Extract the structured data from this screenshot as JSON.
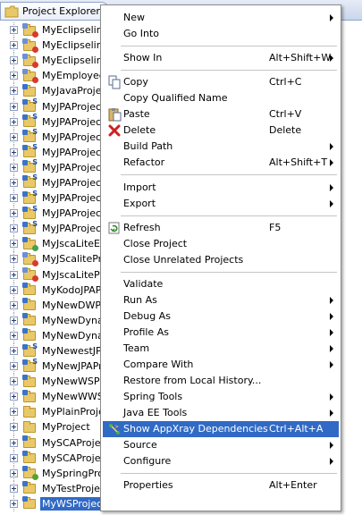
{
  "view": {
    "tab_label": "Project Explorer",
    "projects": [
      {
        "label": "MyEclipselinkJ",
        "icon": "project-error-icon"
      },
      {
        "label": "MyEclipselinkJ",
        "icon": "project-error-icon"
      },
      {
        "label": "MyEclipselinkJ",
        "icon": "project-error-icon"
      },
      {
        "label": "MyEmployeeJ",
        "icon": "project-error-icon"
      },
      {
        "label": "MyJavaProject",
        "icon": "java-project-icon"
      },
      {
        "label": "MyJPAProject",
        "icon": "jpa-project-icon"
      },
      {
        "label": "MyJPAProject",
        "icon": "jpa-project-icon"
      },
      {
        "label": "MyJPAProject",
        "icon": "jpa-project-icon"
      },
      {
        "label": "MyJPAProject",
        "icon": "jpa-project-icon"
      },
      {
        "label": "MyJPAProject",
        "icon": "jpa-project-icon"
      },
      {
        "label": "MyJPAProject",
        "icon": "jpa-project-icon"
      },
      {
        "label": "MyJPAProject",
        "icon": "jpa-project-icon"
      },
      {
        "label": "MyJPAProject",
        "icon": "jpa-project-icon"
      },
      {
        "label": "MyJPAProject",
        "icon": "jpa-project-icon"
      },
      {
        "label": "MyJscaLiteEAR",
        "icon": "ear-project-icon"
      },
      {
        "label": "MyJScaliteProj",
        "icon": "project-error-icon"
      },
      {
        "label": "MyJscaLitePro",
        "icon": "project-error-icon"
      },
      {
        "label": "MyKodoJPAPr",
        "icon": "project-icon"
      },
      {
        "label": "MyNewDWProj",
        "icon": "project-icon"
      },
      {
        "label": "MyNewDynam",
        "icon": "project-icon"
      },
      {
        "label": "MyNewDynam",
        "icon": "project-icon"
      },
      {
        "label": "MyNewestJPA",
        "icon": "jpa-project-icon"
      },
      {
        "label": "MyNewJPAProj",
        "icon": "jpa-project-icon"
      },
      {
        "label": "MyNewWSProj",
        "icon": "project-icon"
      },
      {
        "label": "MyNewWWSPr",
        "icon": "project-icon"
      },
      {
        "label": "MyPlainProject",
        "icon": "folder-icon"
      },
      {
        "label": "MyProject",
        "icon": "folder-icon"
      },
      {
        "label": "MySCAProject",
        "icon": "project-icon"
      },
      {
        "label": "MySCAProject",
        "icon": "project-icon"
      },
      {
        "label": "MySpringProje",
        "icon": "spring-project-icon"
      },
      {
        "label": "MyTestProject",
        "icon": "project-icon"
      },
      {
        "label": "MyWSProject",
        "icon": "project-icon",
        "selected": true
      }
    ]
  },
  "menu": {
    "items": [
      {
        "type": "item",
        "name": "new",
        "label": "New",
        "shortcut": "",
        "submenu": true
      },
      {
        "type": "item",
        "name": "go-into",
        "label": "Go Into",
        "shortcut": ""
      },
      {
        "type": "sep"
      },
      {
        "type": "item",
        "name": "show-in",
        "label": "Show In",
        "shortcut": "Alt+Shift+W",
        "submenu": true
      },
      {
        "type": "sep"
      },
      {
        "type": "item",
        "name": "copy",
        "label": "Copy",
        "shortcut": "Ctrl+C",
        "icon": "copy-icon"
      },
      {
        "type": "item",
        "name": "copy-qualified-name",
        "label": "Copy Qualified Name",
        "shortcut": "",
        "icon": "copy-qualified-icon"
      },
      {
        "type": "item",
        "name": "paste",
        "label": "Paste",
        "shortcut": "Ctrl+V",
        "icon": "paste-icon"
      },
      {
        "type": "item",
        "name": "delete",
        "label": "Delete",
        "shortcut": "Delete",
        "icon": "delete-icon"
      },
      {
        "type": "item",
        "name": "build-path",
        "label": "Build Path",
        "shortcut": "",
        "submenu": true
      },
      {
        "type": "item",
        "name": "refactor",
        "label": "Refactor",
        "shortcut": "Alt+Shift+T",
        "submenu": true
      },
      {
        "type": "sep"
      },
      {
        "type": "item",
        "name": "import",
        "label": "Import",
        "shortcut": "",
        "submenu": true
      },
      {
        "type": "item",
        "name": "export",
        "label": "Export",
        "shortcut": "",
        "submenu": true
      },
      {
        "type": "sep"
      },
      {
        "type": "item",
        "name": "refresh",
        "label": "Refresh",
        "shortcut": "F5",
        "icon": "refresh-icon"
      },
      {
        "type": "item",
        "name": "close-project",
        "label": "Close Project",
        "shortcut": ""
      },
      {
        "type": "item",
        "name": "close-unrelated-projects",
        "label": "Close Unrelated Projects",
        "shortcut": ""
      },
      {
        "type": "sep"
      },
      {
        "type": "item",
        "name": "validate",
        "label": "Validate",
        "shortcut": ""
      },
      {
        "type": "item",
        "name": "run-as",
        "label": "Run As",
        "shortcut": "",
        "submenu": true
      },
      {
        "type": "item",
        "name": "debug-as",
        "label": "Debug As",
        "shortcut": "",
        "submenu": true
      },
      {
        "type": "item",
        "name": "profile-as",
        "label": "Profile As",
        "shortcut": "",
        "submenu": true
      },
      {
        "type": "item",
        "name": "team",
        "label": "Team",
        "shortcut": "",
        "submenu": true
      },
      {
        "type": "item",
        "name": "compare-with",
        "label": "Compare With",
        "shortcut": "",
        "submenu": true
      },
      {
        "type": "item",
        "name": "restore-from-local-history",
        "label": "Restore from Local History...",
        "shortcut": ""
      },
      {
        "type": "item",
        "name": "spring-tools",
        "label": "Spring Tools",
        "shortcut": "",
        "submenu": true
      },
      {
        "type": "item",
        "name": "java-ee-tools",
        "label": "Java EE Tools",
        "shortcut": "",
        "submenu": true
      },
      {
        "type": "item",
        "name": "show-appxray-dependencies",
        "label": "Show AppXray Dependencies",
        "shortcut": "Ctrl+Alt+A",
        "icon": "appxray-icon",
        "highlighted": true
      },
      {
        "type": "item",
        "name": "source",
        "label": "Source",
        "shortcut": "",
        "submenu": true
      },
      {
        "type": "item",
        "name": "configure",
        "label": "Configure",
        "shortcut": "",
        "submenu": true
      },
      {
        "type": "sep"
      },
      {
        "type": "item",
        "name": "properties",
        "label": "Properties",
        "shortcut": "Alt+Enter"
      }
    ]
  },
  "colors": {
    "selection": "#316ac5",
    "menu_border": "#8c8c8c",
    "separator": "#c5c5c5"
  }
}
